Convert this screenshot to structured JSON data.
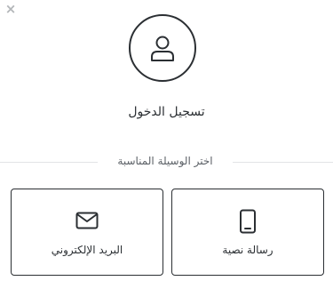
{
  "close": {
    "glyph": "×",
    "icon": "close-icon"
  },
  "header": {
    "icon": "user-icon",
    "title": "تسجيل الدخول"
  },
  "method_prompt": "اختر الوسيلة المناسبة",
  "options": [
    {
      "id": "sms",
      "icon": "mobile-phone-icon",
      "label": "رسالة نصية"
    },
    {
      "id": "email",
      "icon": "envelope-icon",
      "label": "البريد الإلكتروني"
    }
  ],
  "colors": {
    "text": "#2b2f33",
    "muted": "#b3b6b9",
    "divider": "#e2e4e6"
  }
}
